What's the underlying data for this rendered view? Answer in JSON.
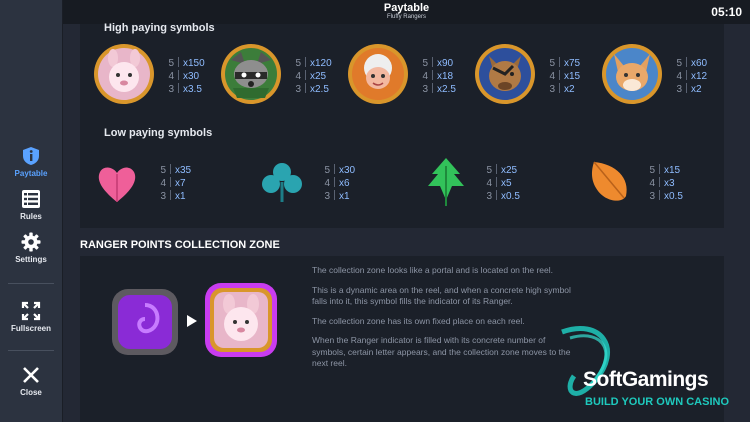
{
  "header": {
    "title": "Paytable",
    "subtitle": "Fluffy Rangers",
    "clock": "05:10"
  },
  "sidebar": {
    "items": [
      {
        "label": "Paytable",
        "icon": "info-shield-icon",
        "active": true
      },
      {
        "label": "Rules",
        "icon": "list-icon"
      },
      {
        "label": "Settings",
        "icon": "gear-icon"
      },
      {
        "label": "Fullscreen",
        "icon": "fullscreen-icon"
      },
      {
        "label": "Close",
        "icon": "close-icon"
      }
    ]
  },
  "high": {
    "heading": "High paying symbols",
    "symbols": [
      {
        "name": "sheep",
        "counts": [
          "5",
          "4",
          "3"
        ],
        "pays": [
          "x150",
          "x30",
          "x3.5"
        ]
      },
      {
        "name": "raccoon",
        "counts": [
          "5",
          "4",
          "3"
        ],
        "pays": [
          "x120",
          "x25",
          "x2.5"
        ]
      },
      {
        "name": "monkey",
        "counts": [
          "5",
          "4",
          "3"
        ],
        "pays": [
          "x90",
          "x18",
          "x2.5"
        ]
      },
      {
        "name": "wolf",
        "counts": [
          "5",
          "4",
          "3"
        ],
        "pays": [
          "x75",
          "x15",
          "x2"
        ]
      },
      {
        "name": "fox",
        "counts": [
          "5",
          "4",
          "3"
        ],
        "pays": [
          "x60",
          "x12",
          "x2"
        ]
      }
    ]
  },
  "low": {
    "heading": "Low paying symbols",
    "symbols": [
      {
        "name": "pink-leaf",
        "counts": [
          "5",
          "4",
          "3"
        ],
        "pays": [
          "x35",
          "x7",
          "x1"
        ]
      },
      {
        "name": "teal-leaf",
        "counts": [
          "5",
          "4",
          "3"
        ],
        "pays": [
          "x30",
          "x6",
          "x1"
        ]
      },
      {
        "name": "green-leaf",
        "counts": [
          "5",
          "4",
          "3"
        ],
        "pays": [
          "x25",
          "x5",
          "x0.5"
        ]
      },
      {
        "name": "orange-leaf",
        "counts": [
          "5",
          "4",
          "3"
        ],
        "pays": [
          "x15",
          "x3",
          "x0.5"
        ]
      }
    ]
  },
  "zone": {
    "heading": "RANGER POINTS COLLECTION ZONE",
    "paragraphs": [
      "The collection zone looks like a portal and is located on the reel.",
      "This is a dynamic area on the reel, and when a concrete high symbol falls into it, this symbol fills the indicator of its Ranger.",
      "The collection zone has its own fixed place on each reel.",
      "When the Ranger indicator is filled with its concrete number of symbols, certain letter appears, and the collection zone moves to the next reel."
    ]
  },
  "watermark": {
    "brand": "SoftGamings",
    "tagline": "BUILD YOUR OWN CASINO"
  },
  "colors": {
    "accent": "#5aa2ff",
    "background": "#232834",
    "panel": "#1b2029",
    "brand_teal": "#1ec9bd"
  }
}
